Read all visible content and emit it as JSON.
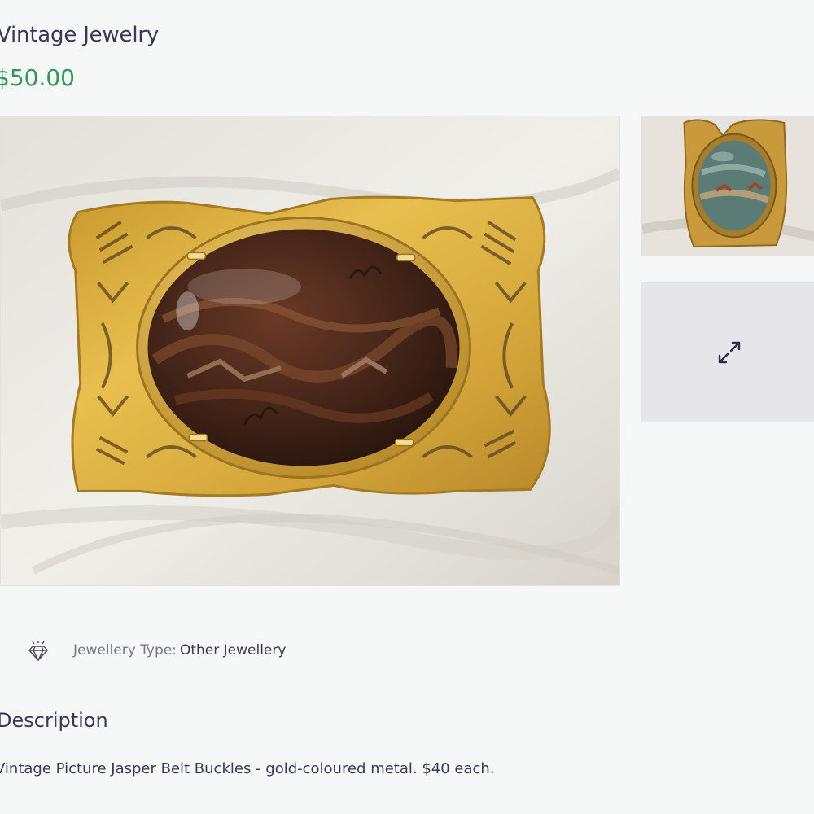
{
  "listing": {
    "title": "Vintage Jewelry",
    "price": "$50.00"
  },
  "gallery": {
    "main_image_subject": "gold-tone belt buckle with oval brown picture jasper cabochon on white linen",
    "thumbnail_subject": "gold-tone buckle with oval green-banded stone",
    "expand_icon": "expand-arrows-icon"
  },
  "attributes": [
    {
      "icon": "diamond-icon",
      "label": "Jewellery Type:",
      "value": "Other Jewellery"
    }
  ],
  "description": {
    "heading": "Description",
    "text": "Vintage Picture Jasper Belt Buckles - gold-coloured metal. $40 each."
  },
  "colors": {
    "background": "#f6f7f7",
    "price": "#2f9a57",
    "text": "#3a3955",
    "muted": "#77778a",
    "tile": "#e5e5ea"
  }
}
